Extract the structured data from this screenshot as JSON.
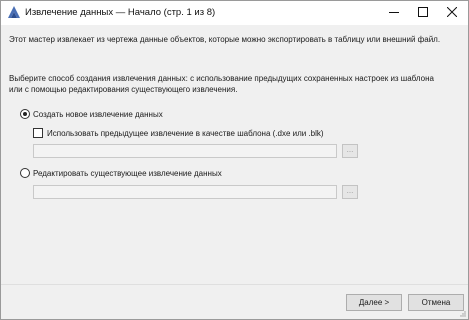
{
  "window": {
    "title": "Извлечение данных — Начало (стр. 1 из 8)",
    "controls": {
      "minimize_icon": "minimize-icon",
      "maximize_icon": "maximize-icon",
      "close_icon": "close-icon"
    }
  },
  "main": {
    "intro_text": "Этот мастер извлекает из чертежа данные объектов, которые можно экспортировать в таблицу или внешний файл.",
    "choose_text": "Выберите способ создания извлечения данных: с использование предыдущих сохраненных настроек из шаблона или с помощью редактирования существующего извлечения.",
    "option_new": {
      "label": "Создать новое извлечение данных",
      "selected": true
    },
    "use_template": {
      "label": "Использовать предыдущее извлечение в качестве шаблона (.dxe или .blk)",
      "checked": false,
      "path_value": "",
      "browse_label": "..."
    },
    "option_edit": {
      "label": "Редактировать существующее извлечение данных",
      "selected": false
    },
    "edit_existing": {
      "path_value": "",
      "browse_label": "..."
    }
  },
  "footer": {
    "next_label": "Далее >",
    "cancel_label": "Отмена"
  },
  "colors": {
    "window_bg": "#f0f0f0",
    "titlebar_bg": "#ffffff",
    "app_icon": "#4a6fb5"
  }
}
